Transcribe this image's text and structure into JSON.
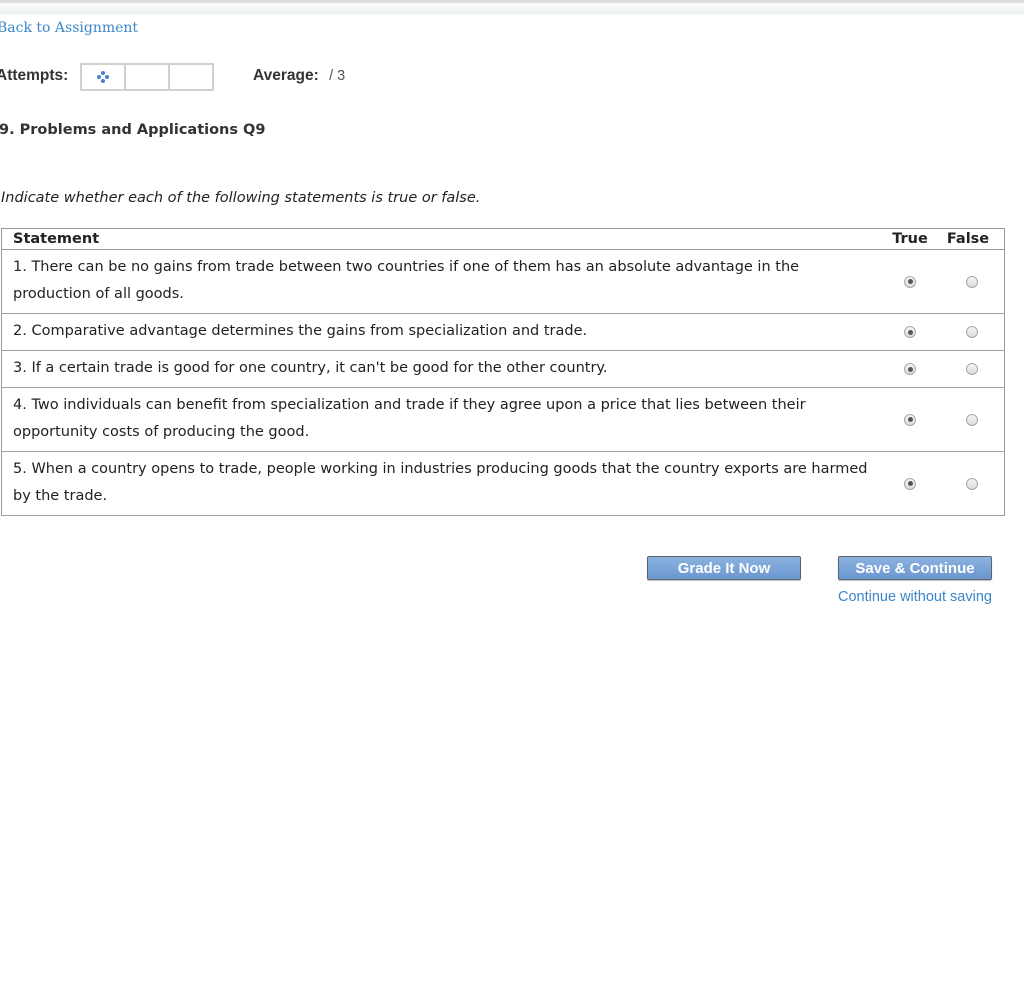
{
  "nav": {
    "back_link": "Back to Assignment"
  },
  "attempts": {
    "label": "Attempts:",
    "boxes": [
      {
        "state": "current",
        "icon": "loading-dots-icon"
      },
      {
        "state": "empty"
      },
      {
        "state": "empty"
      }
    ]
  },
  "average": {
    "label": "Average:",
    "value": "/ 3"
  },
  "question": {
    "title": "9. Problems and Applications Q9",
    "instructions": "Indicate whether each of the following statements is true or false."
  },
  "table": {
    "headers": {
      "statement": "Statement",
      "true": "True",
      "false": "False"
    },
    "rows": [
      {
        "text": "1. There can be no gains from trade between two countries if one of them has an absolute advantage in the production of all goods.",
        "selected": "true"
      },
      {
        "text": "2. Comparative advantage determines the gains from specialization and trade.",
        "selected": "true"
      },
      {
        "text": "3. If a certain trade is good for one country, it can't be good for the other country.",
        "selected": "true"
      },
      {
        "text": "4. Two individuals can benefit from specialization and trade if they agree upon a price that lies between their opportunity costs of producing the good.",
        "selected": "true"
      },
      {
        "text": "5. When a country opens to trade, people working in industries producing goods that the country exports are harmed by the trade.",
        "selected": "true"
      }
    ]
  },
  "actions": {
    "grade_label": "Grade It Now",
    "save_label": "Save & Continue",
    "continue_label": "Continue without saving"
  },
  "colors": {
    "link": "#3a86c8",
    "button": "#7aa5d8",
    "attempt_icon": "#4a7fd6"
  }
}
